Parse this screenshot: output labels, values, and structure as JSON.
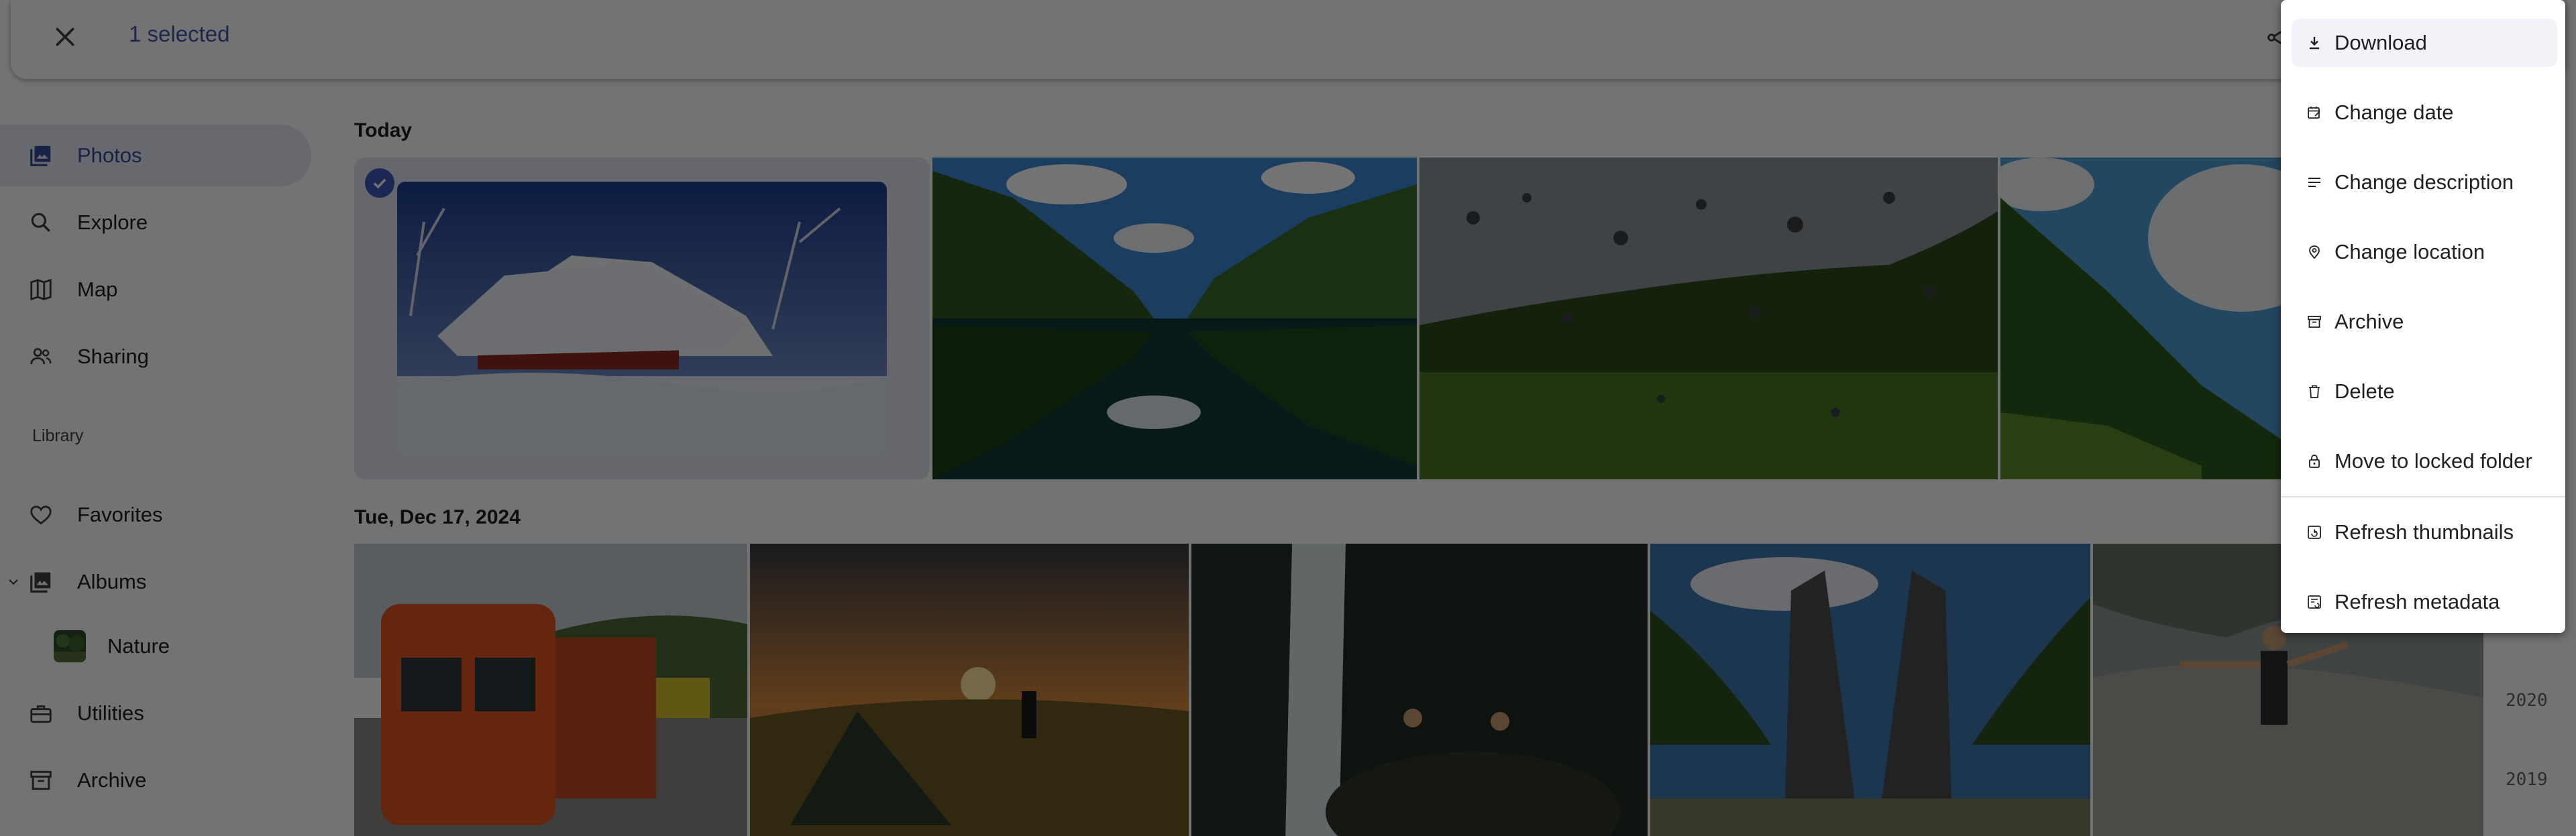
{
  "appbar": {
    "selected_label": "1 selected",
    "close_icon": "close-icon",
    "share_icon": "share-icon"
  },
  "sidebar": {
    "items": [
      {
        "label": "Photos",
        "icon": "photos-icon",
        "active": true
      },
      {
        "label": "Explore",
        "icon": "search-icon"
      },
      {
        "label": "Map",
        "icon": "map-icon"
      },
      {
        "label": "Sharing",
        "icon": "people-icon"
      }
    ],
    "library_heading": "Library",
    "library_items": [
      {
        "label": "Favorites",
        "icon": "heart-icon"
      },
      {
        "label": "Albums",
        "icon": "album-icon"
      },
      {
        "label": "Nature",
        "icon": "album-thumbnail"
      },
      {
        "label": "Utilities",
        "icon": "toolbox-icon"
      },
      {
        "label": "Archive",
        "icon": "archive-icon"
      }
    ]
  },
  "timeline": {
    "groups": [
      {
        "date": "Today",
        "photos": [
          "Snow-covered house",
          "Mountain lake reflection",
          "Raindrops on window",
          "Mountain slope"
        ]
      },
      {
        "date": "Tue, Dec 17, 2024",
        "photos": [
          "Orange train",
          "Tent at sunset",
          "Waterfall",
          "Temple gate",
          "Hiker on rocks"
        ]
      }
    ],
    "years": [
      "2020",
      "2019"
    ]
  },
  "menu": {
    "items": [
      {
        "label": "Download",
        "icon": "download-icon"
      },
      {
        "label": "Change date",
        "icon": "calendar-edit-icon"
      },
      {
        "label": "Change description",
        "icon": "description-icon"
      },
      {
        "label": "Change location",
        "icon": "location-edit-icon"
      },
      {
        "label": "Archive",
        "icon": "archive-icon"
      },
      {
        "label": "Delete",
        "icon": "trash-icon"
      },
      {
        "label": "Move to locked folder",
        "icon": "lock-icon"
      },
      {
        "label": "Refresh thumbnails",
        "icon": "refresh-thumbnails-icon"
      },
      {
        "label": "Refresh metadata",
        "icon": "refresh-metadata-icon"
      }
    ]
  },
  "colors": {
    "accent": "#3f5ab9",
    "active_nav_bg": "#e6e9f4",
    "scrim": "rgba(0,0,0,0.55)"
  }
}
